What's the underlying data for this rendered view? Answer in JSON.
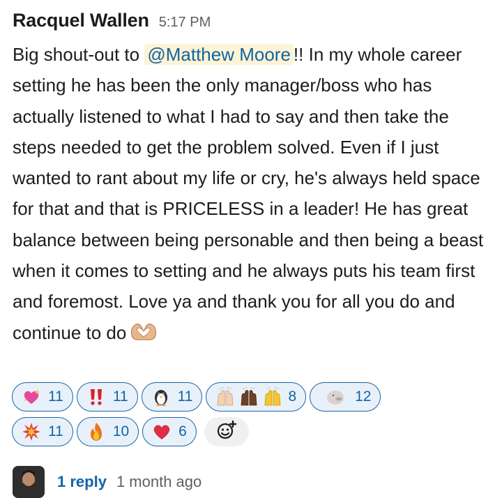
{
  "message": {
    "author": "Racquel Wallen",
    "time": "5:17 PM",
    "text_before": "Big shout-out to ",
    "mention": "@Matthew Moore",
    "text_after": "!! In my whole career setting he has been the only manager/boss who has actually listened to what I had to say and then take the steps needed to get the problem solved. Even if I just wanted to rant about my life or cry, he's always held space for that and that is PRICELESS in a leader! He has great balance between being personable and then being a beast when it comes to setting and he always puts his team first and foremost. Love ya and thank you for all you do and continue to do",
    "trailing_emoji": "heart-hands-emoji"
  },
  "reactions": {
    "row1": [
      {
        "emoji": "sparkling-heart",
        "count": "11"
      },
      {
        "emoji": "double-exclamation",
        "count": "11"
      },
      {
        "emoji": "penguin",
        "count": "11"
      },
      {
        "emoji": "raised-hands-group",
        "count": "8"
      },
      {
        "emoji": "pig-face",
        "count": "12"
      }
    ],
    "row2": [
      {
        "emoji": "collision",
        "count": "11"
      },
      {
        "emoji": "fire",
        "count": "10"
      },
      {
        "emoji": "red-heart",
        "count": "6"
      }
    ],
    "add_reaction_icon": "add-emoji-icon"
  },
  "thread": {
    "reply_label": "1 reply",
    "reply_time": "1 month ago"
  },
  "colors": {
    "link": "#1264a3",
    "mention_bg": "#fdf3d5",
    "pill_bg": "#e8f1fa",
    "pill_border": "#1d63a3"
  }
}
